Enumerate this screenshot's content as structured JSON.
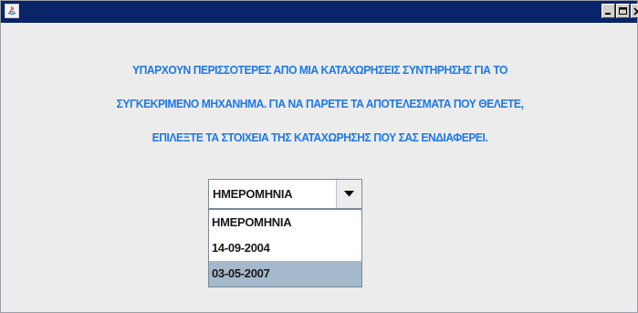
{
  "window": {
    "title": ""
  },
  "message": {
    "line1": "ΥΠΑΡΧΟΥΝ ΠΕΡΙΣΣΟΤΕΡΕΣ ΑΠΟ ΜΙΑ ΚΑΤΑΧΩΡΗΣΕΙΣ ΣΥΝΤΗΡΗΣΗΣ ΓΙΑ ΤΟ",
    "line2": "ΣΥΓΚΕΚΡΙΜΕΝΟ ΜΗΧΑΝΗΜΑ. ΓΙΑ ΝΑ ΠΑΡΕΤΕ ΤΑ ΑΠΟΤΕΛΕΣΜΑΤΑ ΠΟΥ ΘΕΛΕΤΕ,",
    "line3": "ΕΠΙΛΕΞΤΕ ΤΑ ΣΤΟΙΧΕΙΑ ΤΗΣ ΚΑΤΑΧΩΡΗΣΗΣ ΠΟΥ ΣΑΣ ΕΝΔΙΑΦΕΡΕΙ."
  },
  "combo": {
    "selected_value": "ΗΜΕΡΟΜΗΝΙΑ",
    "options": [
      "ΗΜΕΡΟΜΗΝΙΑ",
      "14-09-2004",
      "03-05-2007"
    ],
    "highlighted_option": "03-05-2007"
  },
  "colors": {
    "titlebar": "#0a246a",
    "message_text": "#1e78e6",
    "highlight": "#a5b8cc",
    "window_bg": "#ececec"
  },
  "icons": {
    "app": "java-icon",
    "minimize": "minimize-icon",
    "maximize": "maximize-icon",
    "close": "close-icon",
    "dropdown": "chevron-down-icon"
  }
}
